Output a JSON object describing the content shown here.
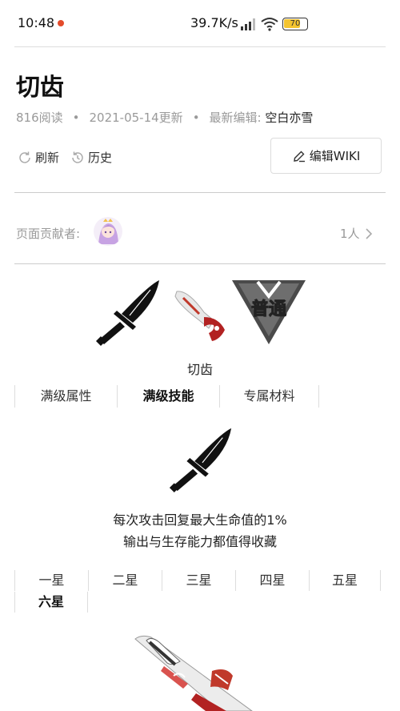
{
  "status_bar": {
    "time": "10:48",
    "net_speed": "39.7K/s",
    "battery": "70",
    "colors": {
      "battery_fill": "#f4c430",
      "notif_dot": "#e34b2b"
    }
  },
  "page": {
    "title": "切齿",
    "meta": {
      "reads": "816阅读",
      "updated": "2021-05-14更新",
      "editor_label": "最新编辑:",
      "editor_name": "空白亦雪"
    },
    "actions": {
      "refresh": "刷新",
      "history": "历史",
      "edit": "编辑WIKI"
    },
    "contributors": {
      "label": "页面贡献者:",
      "count": "1人"
    }
  },
  "item": {
    "name": "切齿",
    "badge_text": "普通",
    "tabs": [
      "满级属性",
      "满级技能",
      "专属材料"
    ],
    "active_tab": 1,
    "skill": {
      "line1": "每次攻击回复最大生命值的1%",
      "line2": "输出与生存能力都值得收藏"
    },
    "stars": [
      "一星",
      "二星",
      "三星",
      "四星",
      "五星",
      "六星"
    ],
    "active_star": 5
  },
  "icons": [
    "refresh-icon",
    "history-icon",
    "edit-icon",
    "chevron-right-icon",
    "sword-icon",
    "signal-icon",
    "wifi-icon",
    "battery-icon"
  ]
}
